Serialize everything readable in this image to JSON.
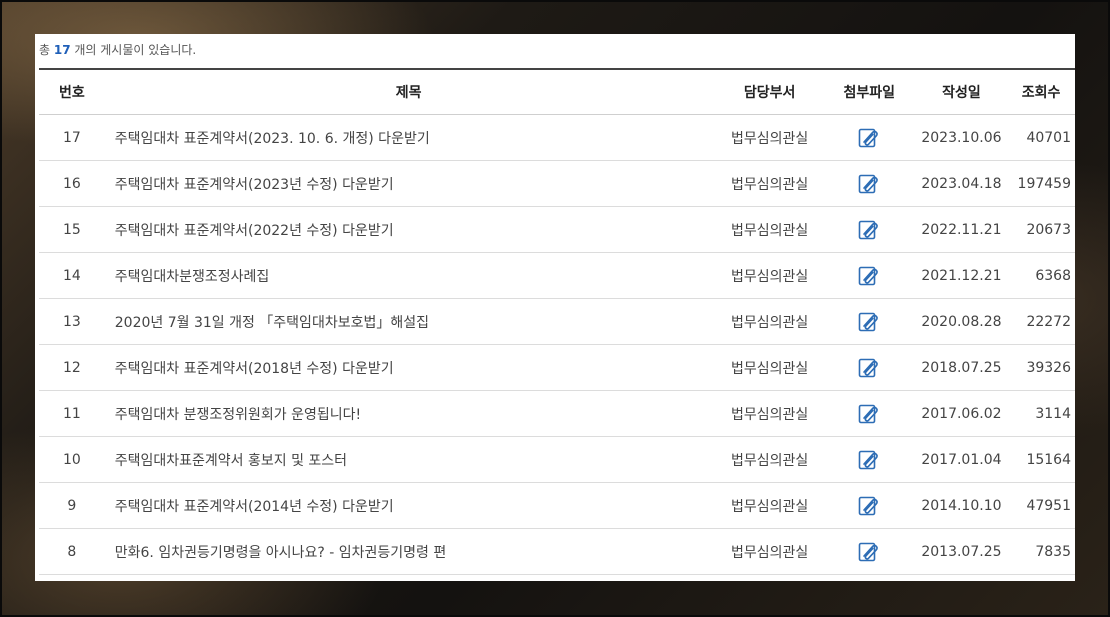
{
  "count_text": {
    "prefix": "총 ",
    "number": "17",
    "suffix": " 개의 게시물이 있습니다."
  },
  "columns": {
    "no": "번호",
    "title": "제목",
    "dept": "담당부서",
    "file": "첨부파일",
    "date": "작성일",
    "views": "조회수"
  },
  "rows": [
    {
      "no": "17",
      "title": "주택임대차 표준계약서(2023. 10. 6. 개정) 다운받기",
      "dept": "법무심의관실",
      "file_icon": "attachment-icon",
      "date": "2023.10.06",
      "views": "40701"
    },
    {
      "no": "16",
      "title": "주택임대차 표준계약서(2023년 수정) 다운받기",
      "dept": "법무심의관실",
      "file_icon": "attachment-icon",
      "date": "2023.04.18",
      "views": "197459"
    },
    {
      "no": "15",
      "title": "주택임대차 표준계약서(2022년 수정) 다운받기",
      "dept": "법무심의관실",
      "file_icon": "attachment-icon",
      "date": "2022.11.21",
      "views": "20673"
    },
    {
      "no": "14",
      "title": "주택임대차분쟁조정사례집",
      "dept": "법무심의관실",
      "file_icon": "attachment-icon",
      "date": "2021.12.21",
      "views": "6368"
    },
    {
      "no": "13",
      "title": "2020년 7월 31일 개정 「주택임대차보호법」해설집",
      "dept": "법무심의관실",
      "file_icon": "attachment-icon",
      "date": "2020.08.28",
      "views": "22272"
    },
    {
      "no": "12",
      "title": "주택임대차 표준계약서(2018년 수정) 다운받기",
      "dept": "법무심의관실",
      "file_icon": "attachment-icon",
      "date": "2018.07.25",
      "views": "39326"
    },
    {
      "no": "11",
      "title": "주택임대차 분쟁조정위원회가 운영됩니다!",
      "dept": "법무심의관실",
      "file_icon": "attachment-icon",
      "date": "2017.06.02",
      "views": "3114"
    },
    {
      "no": "10",
      "title": "주택임대차표준계약서 홍보지 및 포스터",
      "dept": "법무심의관실",
      "file_icon": "attachment-icon",
      "date": "2017.01.04",
      "views": "15164"
    },
    {
      "no": "9",
      "title": "주택임대차 표준계약서(2014년 수정) 다운받기",
      "dept": "법무심의관실",
      "file_icon": "attachment-icon",
      "date": "2014.10.10",
      "views": "47951"
    },
    {
      "no": "8",
      "title": "만화6. 임차권등기명령을 아시나요? - 임차권등기명령 편",
      "dept": "법무심의관실",
      "file_icon": "attachment-icon",
      "date": "2013.07.25",
      "views": "7835"
    }
  ],
  "colors": {
    "accent": "#1f5fb8",
    "header_border": "#444444",
    "icon_blue": "#2d6db5"
  }
}
